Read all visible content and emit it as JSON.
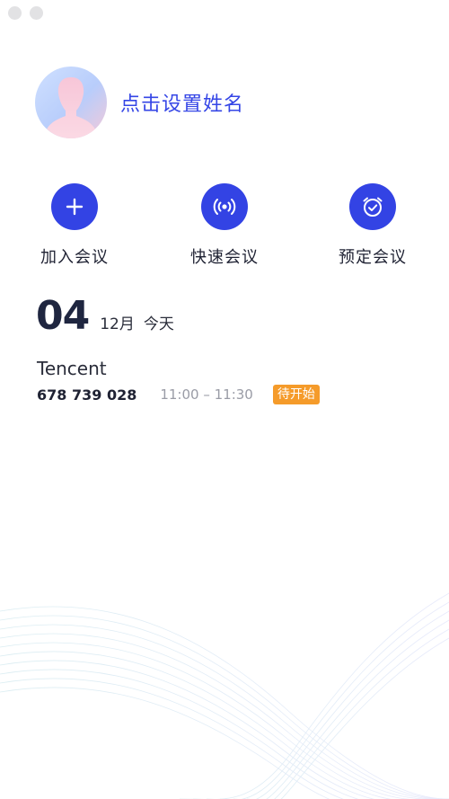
{
  "window": {
    "colors": {
      "accent": "#3343e4",
      "badge": "#f59b2a"
    }
  },
  "profile": {
    "name_prompt": "点击设置姓名",
    "avatar_icon": "person-silhouette-icon"
  },
  "actions": [
    {
      "label": "加入会议",
      "icon": "plus-icon"
    },
    {
      "label": "快速会议",
      "icon": "broadcast-icon"
    },
    {
      "label": "预定会议",
      "icon": "alarm-clock-check-icon"
    }
  ],
  "date": {
    "day": "04",
    "month": "12月",
    "today": "今天"
  },
  "meetings": [
    {
      "title": "Tencent",
      "id": "678 739 028",
      "time": "11:00 – 11:30",
      "status": "待开始"
    }
  ]
}
